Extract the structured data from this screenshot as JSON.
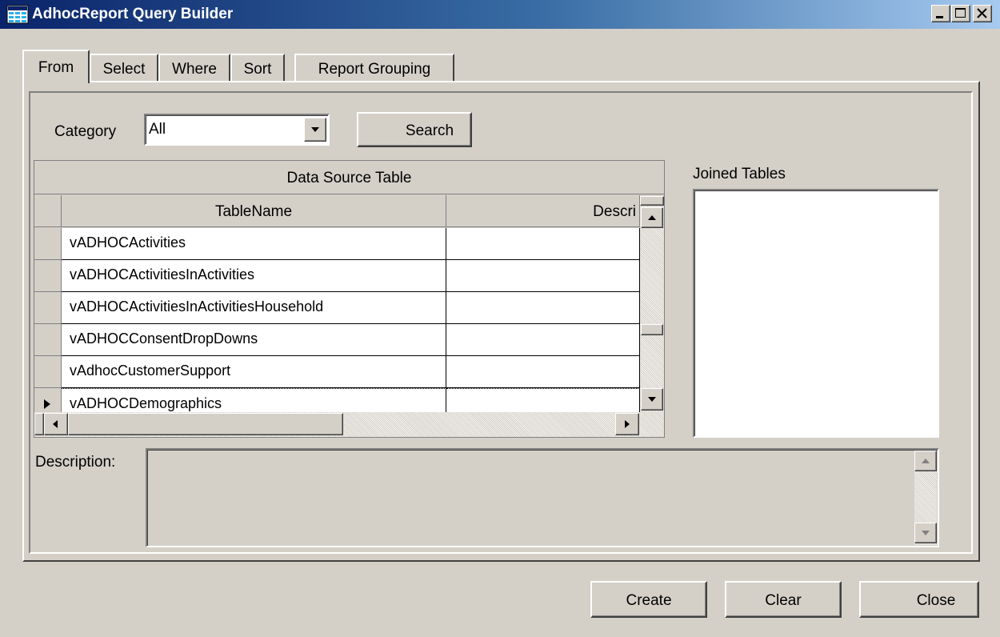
{
  "window": {
    "title": "AdhocReport Query Builder",
    "buttons": {
      "minimize": "minimize-icon",
      "maximize": "maximize-icon",
      "close": "close-icon"
    }
  },
  "tabs": [
    {
      "label": "From",
      "active": true
    },
    {
      "label": "Select",
      "active": false
    },
    {
      "label": "Where",
      "active": false
    },
    {
      "label": "Sort",
      "active": false
    },
    {
      "label": "Report Grouping",
      "active": false
    }
  ],
  "category": {
    "label": "Category",
    "value": "All",
    "search_label": "Search"
  },
  "grid": {
    "caption": "Data Source Table",
    "columns": [
      "TableName",
      "Descri"
    ],
    "rows": [
      {
        "table_name": "vADHOCActivities",
        "description": ""
      },
      {
        "table_name": "vADHOCActivitiesInActivities",
        "description": ""
      },
      {
        "table_name": "vADHOCActivitiesInActivitiesHousehold",
        "description": ""
      },
      {
        "table_name": "vADHOCConsentDropDowns",
        "description": ""
      },
      {
        "table_name": "vAdhocCustomerSupport",
        "description": ""
      },
      {
        "table_name": "vADHOCDemographics",
        "description": ""
      }
    ],
    "current_row": 5
  },
  "joined_tables": {
    "label": "Joined Tables",
    "items": []
  },
  "description": {
    "label": "Description:",
    "value": ""
  },
  "footer": {
    "create_label": "Create",
    "clear_label": "Clear",
    "close_label": "Close"
  },
  "colors": {
    "face": "#d4d0c8",
    "title_start": "#0a246a",
    "title_end": "#a6caf0"
  }
}
